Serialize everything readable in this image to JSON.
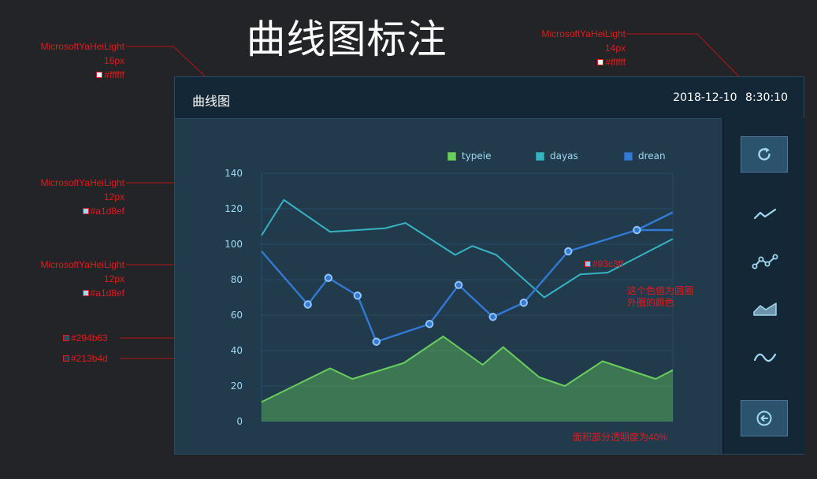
{
  "page": {
    "title": "曲线图标注"
  },
  "panel": {
    "title": "曲线图",
    "datetime": "2018-12-10  8:30:10"
  },
  "legend": [
    {
      "name": "typeie",
      "color": "#69cf5c"
    },
    {
      "name": "dayas",
      "color": "#36b3c3"
    },
    {
      "name": "drean",
      "color": "#327ad4"
    }
  ],
  "annotations": {
    "title_font": {
      "font": "MicrosoftYaHeiLight",
      "size": "16px",
      "color": "#ffffff"
    },
    "time_font": {
      "font": "MicrosoftYaHeiLight",
      "size": "14px",
      "color": "#ffffff"
    },
    "legend_font": {
      "font": "MicrosoftYaHeiLight",
      "size": "12px",
      "color": "#a1d8ef"
    },
    "axis_font": {
      "font": "MicrosoftYaHeiLight",
      "size": "12px",
      "color": "#a1d8ef"
    },
    "color1": "#69cf5c",
    "color2": "#36b3c3",
    "color3": "#327ad4",
    "axis_color": "#294b63",
    "bg_color": "#213b4d",
    "marker_color": "#93c3ff",
    "marker_note": "这个色值为圆圈外圈的颜色",
    "area_note": "面积部分透明度为40%"
  },
  "sidebar": {
    "icons": [
      "refresh-icon",
      "line-chart-icon",
      "point-line-chart-icon",
      "area-chart-icon",
      "smooth-curve-icon",
      "back-icon"
    ]
  },
  "chart_data": {
    "type": "line",
    "x": [
      0,
      1,
      2,
      3,
      4,
      5,
      6,
      7,
      8,
      9,
      10,
      11,
      12,
      13,
      14,
      15,
      16,
      17,
      18,
      19,
      20,
      21,
      22,
      23,
      24
    ],
    "ylim": [
      0,
      140
    ],
    "yticks": [
      0,
      20,
      40,
      60,
      80,
      100,
      120,
      140
    ],
    "grid": true,
    "series": [
      {
        "name": "dayas",
        "color": "#36b3c3",
        "style": "line",
        "x": [
          0,
          1.3,
          4,
          7.2,
          8.4,
          11.3,
          12.3,
          13.7,
          16.5,
          18.6,
          20.2,
          24
        ],
        "y": [
          105,
          125,
          107,
          109,
          112,
          94,
          99,
          94,
          70,
          83,
          84,
          103
        ]
      },
      {
        "name": "drean",
        "color": "#327ad4",
        "style": "line-markers",
        "x": [
          0,
          2.7,
          3.9,
          5.6,
          6.7,
          9.8,
          11.5,
          13.5,
          15.3,
          17.9,
          21.9,
          24
        ],
        "y": [
          96,
          66,
          81,
          71,
          45,
          55,
          77,
          59,
          67,
          96,
          108,
          108
        ],
        "x_tail": [
          21.9,
          24
        ],
        "y_tail": [
          108,
          118
        ]
      },
      {
        "name": "typeie",
        "color": "#69cf5c",
        "style": "area",
        "fill_opacity": 0.4,
        "x": [
          0,
          4,
          5.3,
          8.3,
          10.6,
          12.9,
          14.1,
          16.2,
          17.7,
          19.9,
          23,
          24
        ],
        "y": [
          11,
          30,
          24,
          33,
          48,
          32,
          42,
          25,
          20,
          34,
          24,
          29
        ]
      }
    ]
  }
}
